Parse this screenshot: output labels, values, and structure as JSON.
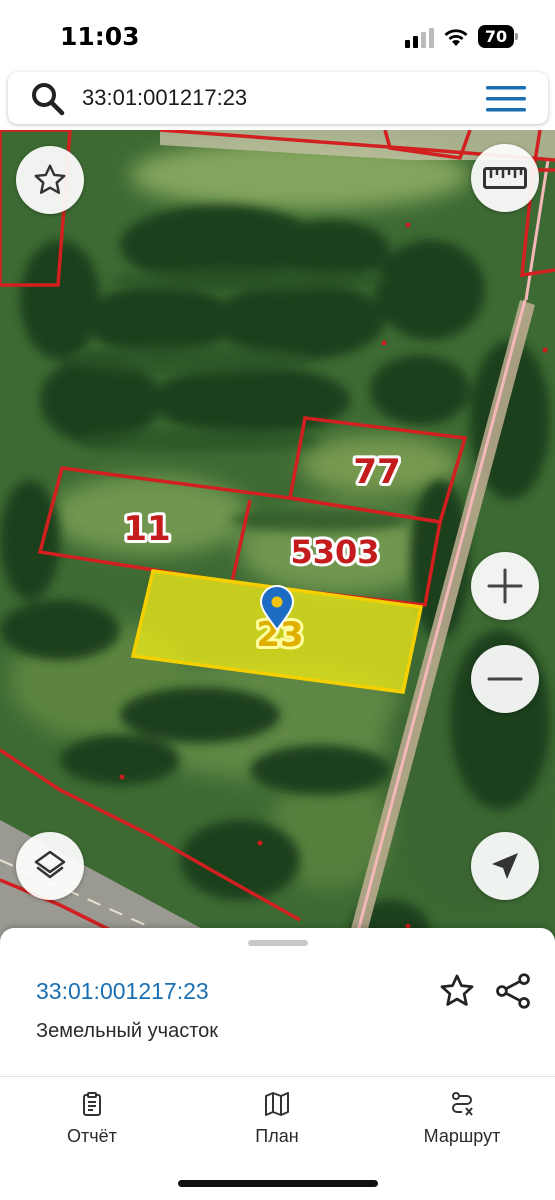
{
  "status_bar": {
    "time": "11:03",
    "battery": "70"
  },
  "search": {
    "query": "33:01:001217:23",
    "icon": "search-icon",
    "menu_icon": "menu-icon"
  },
  "map": {
    "parcels": {
      "p77": "77",
      "p11": "11",
      "p5303": "5303",
      "p23": "23"
    },
    "colors": {
      "boundary": "#d21f1f",
      "selected_fill": "#e8e61a",
      "selected_border": "#f5d000",
      "road": "#e9a0a0"
    },
    "buttons": {
      "favorite": "star-icon",
      "ruler": "ruler-icon",
      "zoom_in": "plus-icon",
      "zoom_out": "minus-icon",
      "layers": "layers-icon",
      "locate": "location-arrow-icon"
    }
  },
  "sheet": {
    "title": "33:01:001217:23",
    "subtitle": "Земельный участок",
    "accent": "#1a6fb3"
  },
  "tabs": [
    {
      "label": "Отчёт",
      "icon": "report-icon"
    },
    {
      "label": "План",
      "icon": "map-icon"
    },
    {
      "label": "Маршрут",
      "icon": "route-icon"
    }
  ]
}
